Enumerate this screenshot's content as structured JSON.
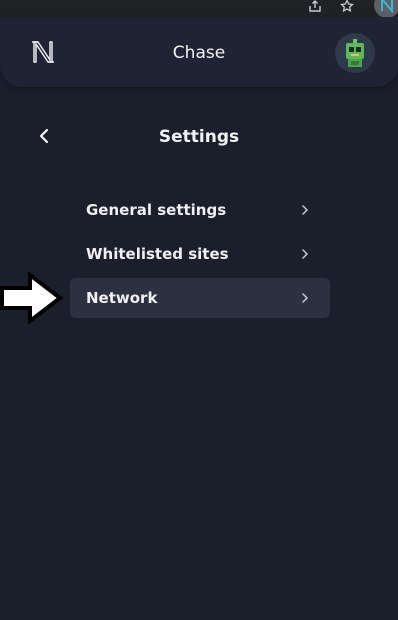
{
  "header": {
    "account_name": "Chase",
    "logo_icon": "n-logo-icon",
    "avatar_icon": "robot-avatar-icon"
  },
  "settings": {
    "title": "Settings",
    "back_icon": "chevron-left-icon",
    "items": [
      {
        "label": "General settings",
        "active": false
      },
      {
        "label": "Whitelisted sites",
        "active": false
      },
      {
        "label": "Network",
        "active": true
      }
    ]
  },
  "colors": {
    "background": "#1b1f2c",
    "header": "#1f2333",
    "active_item": "#2c3140",
    "text": "#eef0f4"
  }
}
